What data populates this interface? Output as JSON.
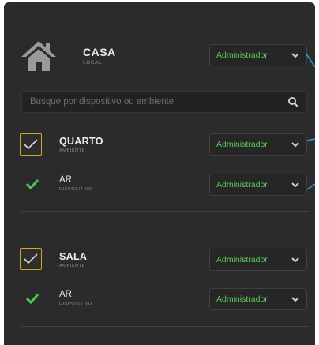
{
  "colors": {
    "panel_bg": "#2b2b2b",
    "accent_green": "#5cc85c",
    "checkbox_border": "#d9a227",
    "pointer_blue": "#29a8d8"
  },
  "home": {
    "title": "CASA",
    "subtitle": "LOCAL",
    "icon": "house-icon",
    "role": "Administrador"
  },
  "search": {
    "placeholder": "Busque por dispositivo ou ambiente",
    "icon": "search-icon"
  },
  "rooms": [
    {
      "name": "QUARTO",
      "type_label": "AMBIENTE",
      "role": "Administrador",
      "device": {
        "name": "AR",
        "type_label": "DISPOSITIVO",
        "role": "Administrador"
      }
    },
    {
      "name": "SALA",
      "type_label": "AMBIENTE",
      "role": "Administrador",
      "device": {
        "name": "AR",
        "type_label": "DISPOSITIVO",
        "role": "Administrador"
      }
    }
  ]
}
